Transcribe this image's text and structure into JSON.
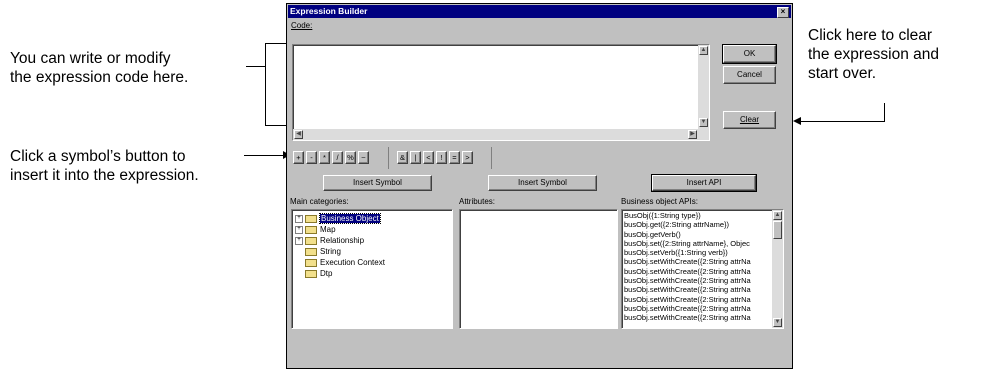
{
  "callouts": {
    "code_area": "You can write or modify\nthe expression code here.",
    "clear": "Click here to clear\nthe expression and\nstart over.",
    "symbol": "Click a symbol’s button to\ninsert it into the expression."
  },
  "dialog": {
    "title": "Expression Builder",
    "close_glyph": "×",
    "code_label": "Code:",
    "ok_label": "OK",
    "cancel_label": "Cancel",
    "clear_label": "Clear",
    "symbols": [
      "+",
      "-",
      "*",
      "/",
      "%",
      "~",
      "&",
      "|",
      "<",
      "!",
      "=",
      ">"
    ],
    "insert_symbol_label_1": "Insert Symbol",
    "insert_symbol_label_2": "Insert Symbol",
    "insert_api_label": "Insert API",
    "main_categories_label": "Main categories:",
    "attributes_label": "Attributes:",
    "bo_apis_label": "Business object APIs:",
    "categories": [
      {
        "name": "Business Object",
        "expandable": true,
        "selected": true
      },
      {
        "name": "Map",
        "expandable": true,
        "selected": false
      },
      {
        "name": "Relationship",
        "expandable": true,
        "selected": false
      },
      {
        "name": "String",
        "expandable": false,
        "selected": false
      },
      {
        "name": "Execution Context",
        "expandable": false,
        "selected": false
      },
      {
        "name": "Dtp",
        "expandable": false,
        "selected": false
      }
    ],
    "apis": [
      "BusObj({1:String type})",
      "busObj.get({2:String attrName})",
      "busObj.getVerb()",
      "busObj.set({2:String attrName}, Objec",
      "busObj.setVerb({1:String verb})",
      "busObj.setWithCreate({2:String attrNa",
      "busObj.setWithCreate({2:String attrNa",
      "busObj.setWithCreate({2:String attrNa",
      "busObj.setWithCreate({2:String attrNa",
      "busObj.setWithCreate({2:String attrNa",
      "busObj.setWithCreate({2:String attrNa",
      "busObj.setWithCreate({2:String attrNa"
    ],
    "colors": {
      "title_bg": "#000080",
      "face": "#c0c0c0",
      "selection": "#000080"
    }
  }
}
